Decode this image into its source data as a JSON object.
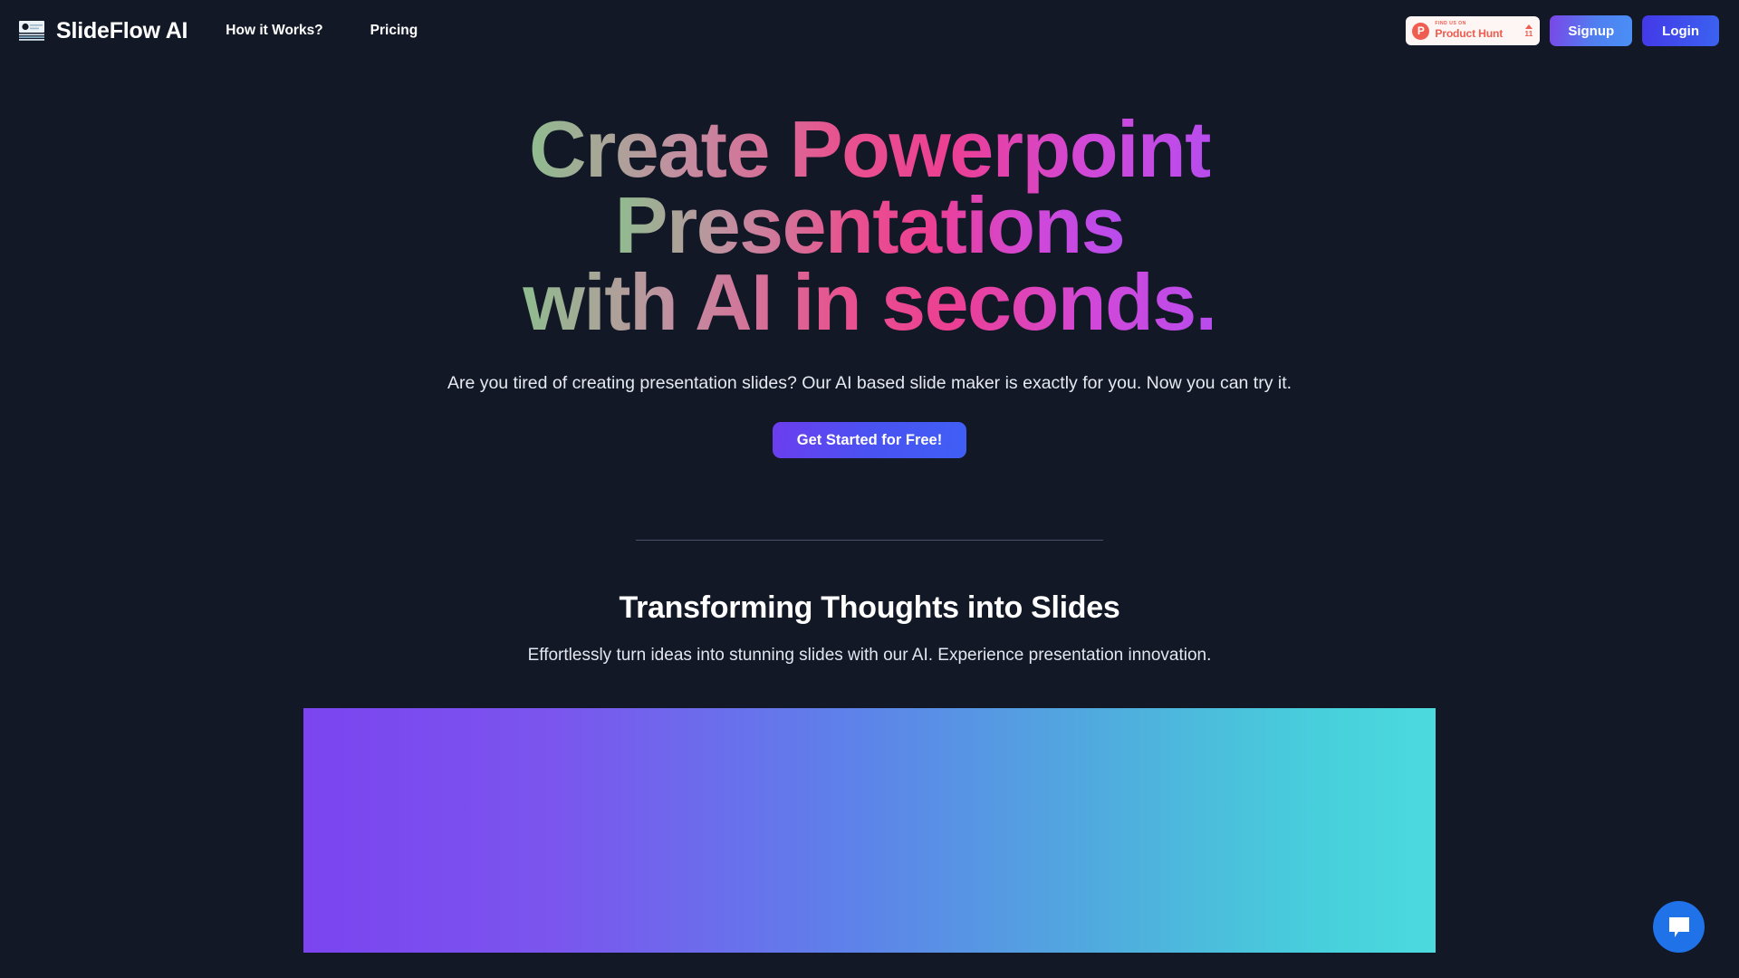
{
  "nav": {
    "logo_icon": "slide-presentation-icon",
    "brand": "SlideFlow AI",
    "links": [
      {
        "label": "How it Works?"
      },
      {
        "label": "Pricing"
      }
    ],
    "product_hunt": {
      "logo_letter": "P",
      "kicker": "FIND US ON",
      "name": "Product Hunt",
      "upvote_icon": "upvote-triangle-icon",
      "upvote_count": "11"
    },
    "signup_label": "Signup",
    "login_label": "Login"
  },
  "hero": {
    "headline_lines": [
      "Create Powerpoint",
      "Presentations",
      "with AI in seconds."
    ],
    "subtitle": "Are you tired of creating presentation slides? Our AI based slide maker is exactly for you. Now you can try it.",
    "cta_label": "Get Started for Free!"
  },
  "section": {
    "title": "Transforming Thoughts into Slides",
    "subtitle": "Effortlessly turn ideas into stunning slides with our AI. Experience presentation innovation."
  },
  "banner": {
    "gradient_from": "#7B44F0",
    "gradient_mid": "#5E81EA",
    "gradient_to": "#4CDADE"
  },
  "chat": {
    "icon": "chat-bubble-icon"
  },
  "colors": {
    "page_background": "#131827",
    "accent_blue": "#4338E8",
    "product_hunt_red": "#EF5D50",
    "headline_gradient_start": "#8FBC8F",
    "headline_gradient_mid": "#EC3F93",
    "headline_gradient_end": "#B84CEE",
    "chat_blue": "#1F72E8"
  }
}
